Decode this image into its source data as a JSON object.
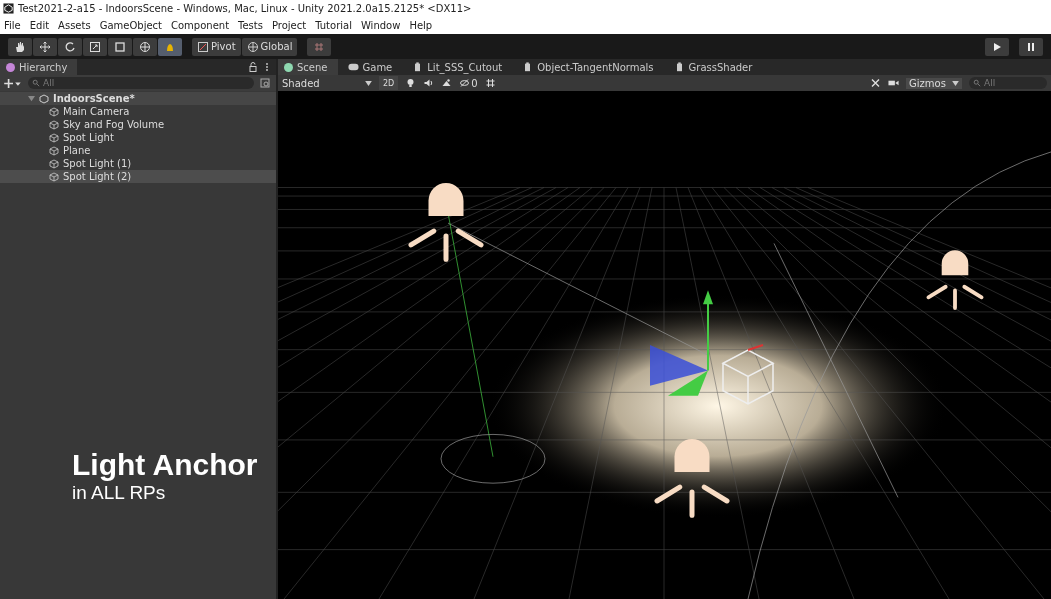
{
  "window": {
    "title": "Test2021-2-a15 - IndoorsScene - Windows, Mac, Linux - Unity 2021.2.0a15.2125* <DX11>"
  },
  "menu": [
    "File",
    "Edit",
    "Assets",
    "GameObject",
    "Component",
    "Tests",
    "Project",
    "Tutorial",
    "Window",
    "Help"
  ],
  "tools": [
    {
      "kind": "hand",
      "selected": false
    },
    {
      "kind": "move",
      "selected": false
    },
    {
      "kind": "rotate",
      "selected": false
    },
    {
      "kind": "scale",
      "selected": false
    },
    {
      "kind": "rect",
      "selected": false
    },
    {
      "kind": "transform",
      "selected": false
    },
    {
      "kind": "custom",
      "selected": true
    }
  ],
  "pivot_buttons": [
    "Pivot",
    "Global"
  ],
  "hierarchy": {
    "title": "Hierarchy",
    "search_placeholder": "All",
    "scene": {
      "label": "IndoorsScene*",
      "expanded": true,
      "children": [
        {
          "label": "Main Camera",
          "selected": false
        },
        {
          "label": "Sky and Fog Volume",
          "selected": false
        },
        {
          "label": "Spot Light",
          "selected": false
        },
        {
          "label": "Plane",
          "selected": false
        },
        {
          "label": "Spot Light (1)",
          "selected": false
        },
        {
          "label": "Spot Light (2)",
          "selected": true
        }
      ]
    }
  },
  "tabs": [
    {
      "label": "Scene",
      "kind": "scene",
      "selected": true
    },
    {
      "label": "Game",
      "kind": "game",
      "selected": false
    },
    {
      "label": "Lit_SSS_Cutout",
      "kind": "shader",
      "selected": false
    },
    {
      "label": "Object-TangentNormals",
      "kind": "shader",
      "selected": false
    },
    {
      "label": "GrassShader",
      "kind": "shader",
      "selected": false
    }
  ],
  "scene_toolbar": {
    "draw_mode": "Shaded",
    "mode_2d": "2D",
    "hidden_count": "0",
    "gizmos": "Gizmos",
    "search_placeholder": "All"
  },
  "caption": {
    "title": "Light Anchor",
    "subtitle": "in ALL RPs"
  }
}
